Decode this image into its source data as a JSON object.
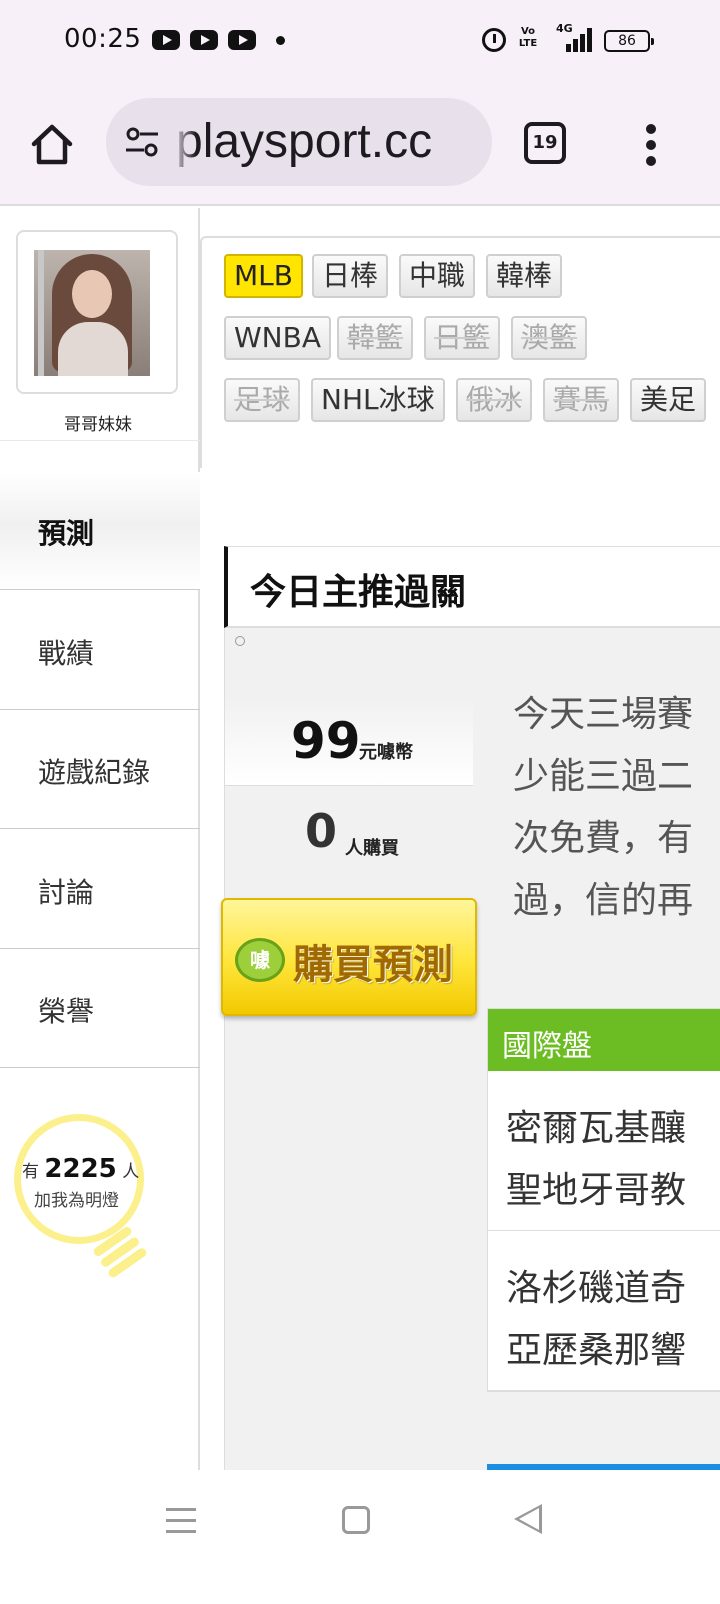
{
  "status_bar": {
    "time": "00:25",
    "volte": "Vo LTE",
    "network": "4G",
    "battery": "86",
    "icons": [
      "youtube-icon",
      "youtube-icon",
      "youtube-icon",
      "notification-dot-icon",
      "alarm-icon",
      "volte-icon",
      "signal-icon",
      "battery-icon"
    ]
  },
  "browser": {
    "url": "playsport.cc",
    "tab_count": "19",
    "icons": [
      "home-icon",
      "site-settings-icon",
      "tabs-icon",
      "more-menu-icon"
    ]
  },
  "sidebar": {
    "user_name": "哥哥妹妹",
    "nav_items": [
      "預測",
      "戰績",
      "遊戲紀錄",
      "討論",
      "榮譽"
    ],
    "active_item": "預測",
    "fans": {
      "prefix": "有",
      "count": "2225",
      "suffix": "人",
      "label": "加我為明燈"
    }
  },
  "sport_tabs": {
    "row1": [
      "MLB",
      "日棒",
      "中職",
      "韓棒"
    ],
    "row2": [
      "WNBA",
      "韓籃",
      "日籃",
      "澳籃"
    ],
    "row3": [
      "足球",
      "NHL冰球",
      "俄冰",
      "賽馬",
      "美足"
    ],
    "active": "MLB",
    "disabled": [
      "韓籃",
      "日籃",
      "澳籃",
      "足球",
      "俄冰",
      "賽馬"
    ]
  },
  "section": {
    "title": "今日主推過關"
  },
  "prediction": {
    "price": "99",
    "price_unit": "元噱幣",
    "buyers": "0",
    "buyers_unit": "人購買",
    "buy_button": "購買預測",
    "coin_glyph": "噱",
    "description_lines": [
      "今天三場賽",
      "少能三過二",
      "次免費，有",
      "過，信的再"
    ]
  },
  "games": {
    "header": "國際盤",
    "rows": [
      [
        "密爾瓦基釀",
        "聖地牙哥教"
      ],
      [
        "洛杉磯道奇",
        "亞歷桑那響"
      ]
    ]
  },
  "colors": {
    "active_tab": "#ffe500",
    "game_header": "#6cbd23",
    "bulb": "#fbf08c",
    "buy_button": "#ffe53a",
    "accent_strip": "#1a8ee0"
  }
}
